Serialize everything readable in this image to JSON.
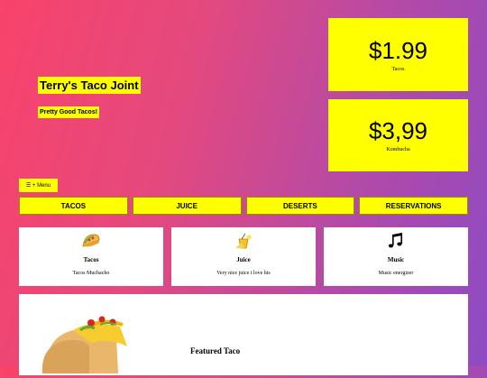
{
  "hero": {
    "title": "Terry's Taco Joint",
    "subtitle": "Pretty Good Tacos!"
  },
  "prices": [
    {
      "amount": "$1.99",
      "label": "Tacos"
    },
    {
      "amount": "$3,99",
      "label": "Kombucha"
    }
  ],
  "menu_button": "☰ + Menu",
  "nav": [
    "TACOS",
    "JUICE",
    "DESERTS",
    "RESERVATIONS"
  ],
  "cards": [
    {
      "icon": "taco-icon",
      "title": "Tacos",
      "desc": "Tacos Muchacho"
    },
    {
      "icon": "juice-icon",
      "title": "Juice",
      "desc": "Very nice juice i love his"
    },
    {
      "icon": "music-note-icon",
      "title": "Music",
      "desc": "Music energizer"
    }
  ],
  "featured": {
    "title": "Featured Taco"
  },
  "colors": {
    "accent": "#ffff00",
    "gradient_start": "#f8436b",
    "gradient_end": "#8e4bc3"
  }
}
